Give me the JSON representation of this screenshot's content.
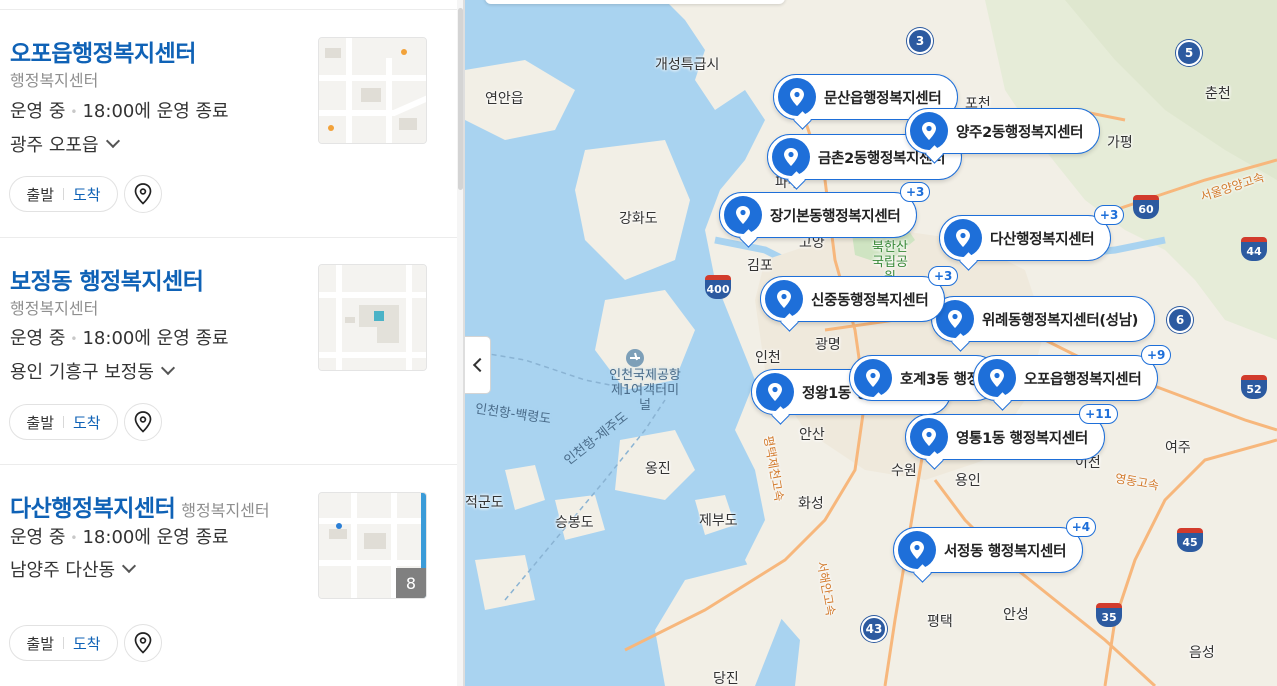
{
  "results": [
    {
      "name": "오포읍행정복지센터",
      "category": "행정복지센터",
      "status": "운영 중",
      "hours": "18:00에 운영 종료",
      "location": "광주 오포읍",
      "route_from": "출발",
      "route_to": "도착"
    },
    {
      "name": "보정동 행정복지센터",
      "category": "행정복지센터",
      "status": "운영 중",
      "hours": "18:00에 운영 종료",
      "location": "용인 기흥구 보정동",
      "route_from": "출발",
      "route_to": "도착"
    },
    {
      "name": "다산행정복지센터",
      "category": "행정복지센터",
      "status": "운영 중",
      "hours": "18:00에 운영 종료",
      "location": "남양주 다산동",
      "route_from": "출발",
      "route_to": "도착",
      "photo_count": "8"
    }
  ],
  "map": {
    "markers": [
      {
        "label": "문산읍행정복지센터",
        "count": ""
      },
      {
        "label": "양주2동행정복지센터",
        "count": ""
      },
      {
        "label": "금촌2동행정복지센터",
        "count": ""
      },
      {
        "label": "장기본동행정복지센터",
        "count": "+3"
      },
      {
        "label": "다산행정복지센터",
        "count": "+3"
      },
      {
        "label": "신중동행정복지센터",
        "count": "+3"
      },
      {
        "label": "위례동행정복지센터(성남)",
        "count": ""
      },
      {
        "label": "정왕1동 행정복지센터",
        "count": ""
      },
      {
        "label": "호계3동 행정복지센터",
        "count": ""
      },
      {
        "label": "오포읍행정복지센터",
        "count": "+9"
      },
      {
        "label": "영통1동 행정복지센터",
        "count": "+11"
      },
      {
        "label": "서정동 행정복지센터",
        "count": "+4"
      }
    ],
    "places": {
      "kaesong": "개성특급시",
      "yeonan": "연안읍",
      "pocheon": "포천",
      "chuncheon": "춘천",
      "gapyeong": "가평",
      "paju": "파주",
      "ganghwa": "강화도",
      "goyang": "고양",
      "gimpo": "김포",
      "bukhansan": "북한산 국립공원",
      "incheon": "인천",
      "gwangmyeong": "광명",
      "airport": "인천국제공항 제1여객터미널",
      "ansan": "안산",
      "ongjin": "옹진",
      "suwon": "수원",
      "yongin": "용인",
      "icheon": "이천",
      "yeoju": "여주",
      "hwaseong": "화성",
      "jeokgeum": "적군도",
      "seungbong": "승봉도",
      "jebudo": "제부도",
      "anseong": "안성",
      "pyeongtaek": "평택",
      "eumseong": "음성",
      "dangjin": "당진",
      "ferry1": "인천항-백령도",
      "ferry2": "인천항-제주도",
      "exp_seoulyangyang": "서울양양고속",
      "exp_pyeongtaek": "평택제천고속",
      "exp_yeongdong": "영동고속",
      "exp_seohaean": "서해안고속"
    },
    "shields": {
      "r3": "3",
      "r5": "5",
      "r43": "43",
      "r6": "6",
      "h60": "60",
      "h44": "44",
      "h400": "400",
      "h52": "52",
      "h45": "45",
      "h35": "35"
    }
  },
  "colors": {
    "accent": "#1e6fd9",
    "link": "#0f62b6",
    "sea": "#a9d3f0",
    "land": "#f2efe6"
  }
}
